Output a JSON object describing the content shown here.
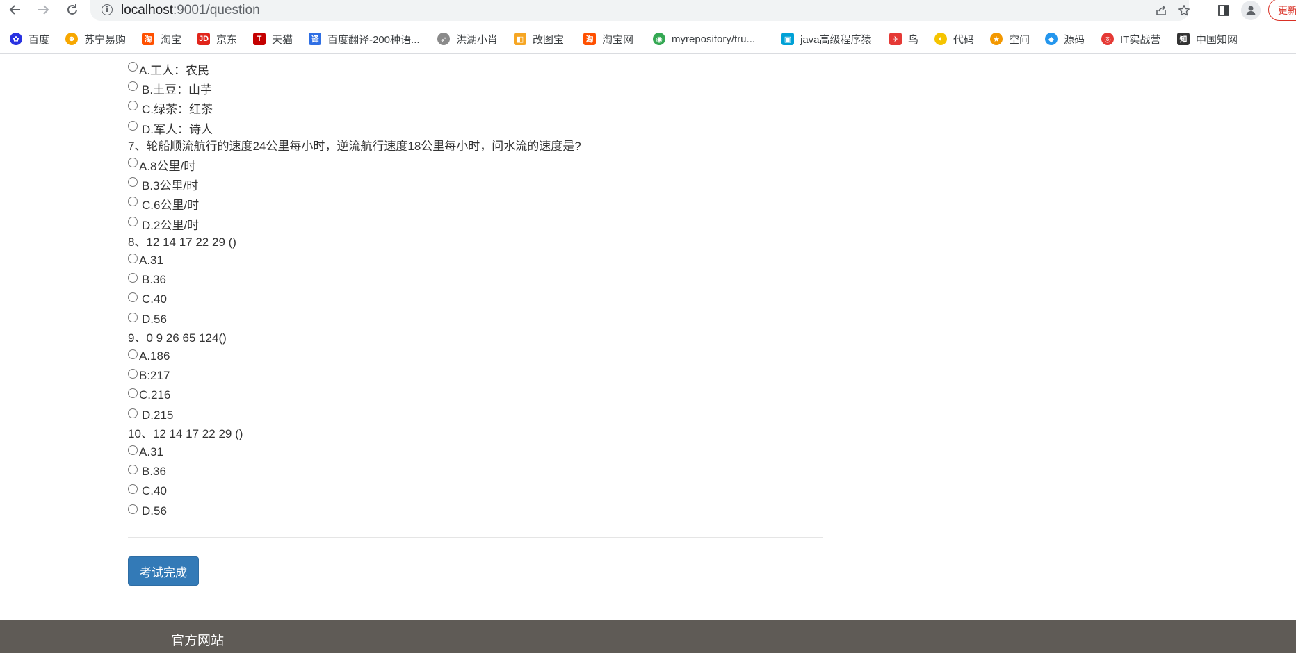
{
  "browser": {
    "url_host": "localhost",
    "url_port_path": ":9001/question",
    "update_label": "更新"
  },
  "bookmarks": [
    {
      "label": "百度",
      "icon": "baidu-paw-icon",
      "color": "#2932e1"
    },
    {
      "label": "苏宁易购",
      "icon": "suning-lion-icon",
      "color": "#f7a700"
    },
    {
      "label": "淘宝",
      "icon": "taobao-icon",
      "color": "#ff5000"
    },
    {
      "label": "京东",
      "icon": "jd-icon",
      "color": "#e1251b"
    },
    {
      "label": "天猫",
      "icon": "tmall-icon",
      "color": "#c40000"
    },
    {
      "label": "百度翻译-200种语...",
      "icon": "translate-icon",
      "color": "#2f6fe4"
    },
    {
      "label": "洪湖小肖",
      "icon": "bird-icon",
      "color": "#888888"
    },
    {
      "label": "改图宝",
      "icon": "gaitubao-icon",
      "color": "#f6a623"
    },
    {
      "label": "淘宝网",
      "icon": "taobao-icon",
      "color": "#ff5000"
    },
    {
      "label": "myrepository/tru...",
      "icon": "chrome-icon",
      "color": "#34a853"
    },
    {
      "label": "java高级程序猿",
      "icon": "bilibili-icon",
      "color": "#00a1d6"
    },
    {
      "label": "鸟",
      "icon": "swallow-icon",
      "color": "#e53935"
    },
    {
      "label": "代码",
      "icon": "half-moon-icon",
      "color": "#f5c400"
    },
    {
      "label": "空间",
      "icon": "qzone-icon",
      "color": "#f39800"
    },
    {
      "label": "源码",
      "icon": "docker-whale-icon",
      "color": "#2496ed"
    },
    {
      "label": "IT实战营",
      "icon": "circle-logo-icon",
      "color": "#e53935"
    },
    {
      "label": "中国知网",
      "icon": "cnki-icon",
      "color": "#333333"
    }
  ],
  "quiz": {
    "partial_top": "",
    "q6_options": [
      {
        "label": "A.工人：农民"
      },
      {
        "label": "B.土豆：山芋"
      },
      {
        "label": "C.绿茶：红茶"
      },
      {
        "label": "D.军人：诗人"
      }
    ],
    "questions": [
      {
        "text": "7、轮船顺流航行的速度24公里每小时，逆流航行速度18公里每小时，问水流的速度是?",
        "options": [
          {
            "label": "A.8公里/时"
          },
          {
            "label": "B.3公里/时"
          },
          {
            "label": "C.6公里/时"
          },
          {
            "label": "D.2公里/时"
          }
        ]
      },
      {
        "text": "8、12 14 17 22 29 ()",
        "options": [
          {
            "label": "A.31"
          },
          {
            "label": "B.36"
          },
          {
            "label": "C.40"
          },
          {
            "label": "D.56"
          }
        ]
      },
      {
        "text": "9、0 9 26 65 124()",
        "options": [
          {
            "label": "A.186"
          },
          {
            "label": "B:217"
          },
          {
            "label": "C.216"
          },
          {
            "label": "D.215"
          }
        ]
      },
      {
        "text": "10、12 14 17 22 29 ()",
        "options": [
          {
            "label": "A.31"
          },
          {
            "label": "B.36"
          },
          {
            "label": "C.40"
          },
          {
            "label": "D.56"
          }
        ]
      }
    ],
    "submit_label": "考试完成"
  },
  "footer": {
    "link_label": "官方网站"
  }
}
